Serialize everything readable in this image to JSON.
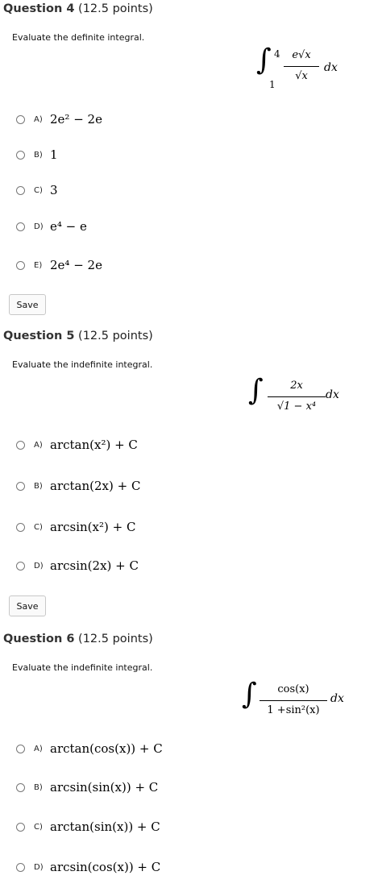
{
  "questions": [
    {
      "number_label": "Question 4",
      "points": "(12.5 points)",
      "instruction": "Evaluate the definite integral.",
      "formula": {
        "upper": "4",
        "lower": "1",
        "numerator": "e√x",
        "denominator": "√x",
        "differential": "dx"
      },
      "options": [
        {
          "letter": "A)",
          "text": "2e² − 2e"
        },
        {
          "letter": "B)",
          "text": "1"
        },
        {
          "letter": "C)",
          "text": "3"
        },
        {
          "letter": "D)",
          "text": "e⁴ − e"
        },
        {
          "letter": "E)",
          "text": "2e⁴ − 2e"
        }
      ],
      "save_label": "Save"
    },
    {
      "number_label": "Question 5",
      "points": "(12.5 points)",
      "instruction": "Evaluate the indefinite integral.",
      "formula": {
        "numerator": "2x",
        "denominator": "√1 − x⁴",
        "differential": "dx"
      },
      "options": [
        {
          "letter": "A)",
          "text": "arctan(x²) + C"
        },
        {
          "letter": "B)",
          "text": "arctan(2x) + C"
        },
        {
          "letter": "C)",
          "text": "arcsin(x²) + C"
        },
        {
          "letter": "D)",
          "text": "arcsin(2x) + C"
        }
      ],
      "save_label": "Save"
    },
    {
      "number_label": "Question 6",
      "points": "(12.5 points)",
      "instruction": "Evaluate the indefinite integral.",
      "formula": {
        "numerator": "cos(x)",
        "denominator": "1 +sin²(x)",
        "differential": "dx"
      },
      "options": [
        {
          "letter": "A)",
          "text": "arctan(cos(x)) + C"
        },
        {
          "letter": "B)",
          "text": "arcsin(sin(x)) + C"
        },
        {
          "letter": "C)",
          "text": "arctan(sin(x)) + C"
        },
        {
          "letter": "D)",
          "text": "arcsin(cos(x)) + C"
        }
      ]
    }
  ]
}
